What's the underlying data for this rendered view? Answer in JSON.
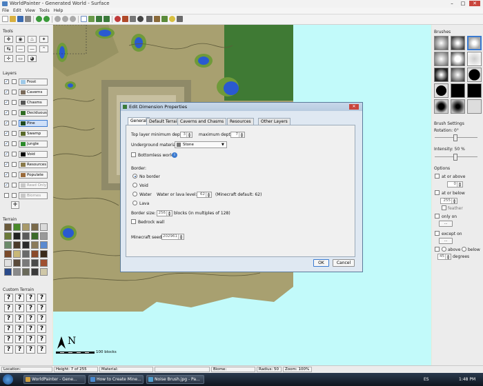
{
  "window": {
    "title": "WorldPainter - Generated World - Surface",
    "controls": [
      "–",
      "□",
      "✕"
    ]
  },
  "menu": [
    "File",
    "Edit",
    "View",
    "Tools",
    "Help"
  ],
  "tools_panel": {
    "label": "Tools",
    "icons": [
      "✥",
      "◉",
      "♨",
      "✦",
      "↹",
      "—",
      "—",
      "⌃",
      "✛",
      "▭",
      "◕"
    ]
  },
  "layers_panel": {
    "label": "Layers",
    "layers": [
      {
        "name": "Frost",
        "color": "#9ec9e8",
        "checked": true
      },
      {
        "name": "Caverns",
        "color": "#7a6a5a",
        "checked": true
      },
      {
        "name": "Chasms",
        "color": "#555555",
        "checked": true
      },
      {
        "name": "Deciduous",
        "color": "#2e6b22",
        "checked": true
      },
      {
        "name": "Pine",
        "color": "#1e4a1e",
        "checked": true,
        "selected": true
      },
      {
        "name": "Swamp",
        "color": "#5a6a2a",
        "checked": true
      },
      {
        "name": "Jungle",
        "color": "#2a8a2a",
        "checked": true
      },
      {
        "name": "Void",
        "color": "#000000",
        "checked": true
      },
      {
        "name": "Resources",
        "color": "#8a7a4a",
        "checked": true
      },
      {
        "name": "Populate",
        "color": "#9a6a3a",
        "checked": true
      },
      {
        "name": "Read Only",
        "color": "#c8c8c8",
        "checked": true,
        "disabled": true
      },
      {
        "name": "Biomes",
        "color": "#c8c8c8",
        "checked": false,
        "disabled": true
      }
    ],
    "add_label": "+"
  },
  "terrain_panel": {
    "label": "Terrain",
    "swatches": [
      "#6a5a3a",
      "#4a8a2a",
      "#a89a6a",
      "#7a6a4a",
      "#dadada",
      "#6a7a3a",
      "#222222",
      "#5a5a5a",
      "#3a6a2a",
      "#9a9a9a",
      "#6a8a6a",
      "#4a3a2a",
      "#2a2a2a",
      "#8a7a5a",
      "#5a8ad0",
      "#7a4a2a",
      "#c8b878",
      "#6a6a6a",
      "#8a4a2a",
      "#3a2a1a",
      "#e0e0e0",
      "#5a4a3a",
      "#7a7a7a",
      "#4a4a4a",
      "#a05030",
      "#2a4a8a",
      "#8a8a8a",
      "#6a6a5a",
      "#3a3a3a",
      "#d0c8a8"
    ]
  },
  "custom_terrain_panel": {
    "label": "Custom Terrain",
    "placeholder": "?",
    "count": 24
  },
  "brushes_panel": {
    "label": "Brushes"
  },
  "brush_settings": {
    "label": "Brush Settings",
    "rotation": "Rotation: 0°",
    "rotation_value": 0,
    "intensity": "Intensity: 50 %",
    "intensity_value": 50
  },
  "options": {
    "label": "Options",
    "at_or_above": "at or above",
    "at_or_above_value": "0",
    "at_or_below": "at or below",
    "at_or_below_value": "255",
    "feather": "feather",
    "only_on": "only on",
    "only_on_value": "...",
    "except_on": "except on",
    "except_on_value": "...",
    "above": "above",
    "below": "below",
    "degrees_value": "45",
    "degrees": "degrees"
  },
  "map": {
    "scale_label": "100 blocks",
    "compass": "N",
    "land_color": "#a8a070",
    "water_color": "#c2fafa"
  },
  "dialog": {
    "title": "Edit Dimension Properties",
    "tabs": [
      "General",
      "Default Terrain",
      "Caverns and Chasms",
      "Resources",
      "Other Layers"
    ],
    "active_tab": "General",
    "top_layer_label": "Top layer minimum depth:",
    "top_layer_value": "3",
    "max_depth_label": "maximum depth:",
    "max_depth_value": "7",
    "underground_label": "Underground material:",
    "underground_value": "Stone",
    "bottomless_label": "Bottomless world",
    "border_label": "Border:",
    "border_options": [
      "No border",
      "Void",
      "Water",
      "Lava"
    ],
    "water_level_label": "Water or lava level:",
    "water_level_value": "62",
    "minecraft_default": "(Minecraft default: 62)",
    "border_size_label": "Border size:",
    "border_size_value": "256",
    "border_size_suffix": "blocks (in multiples of 128)",
    "bedrock_label": "Bedrock wall",
    "seed_label": "Minecraft seed:",
    "seed_value": "202961",
    "ok_label": "OK",
    "cancel_label": "Cancel"
  },
  "status": {
    "location": "Location:",
    "height": "Height: 7 of 255",
    "material": "Material:",
    "biome": "Biome:",
    "radius": "Radius: 50",
    "zoom": "Zoom: 100%"
  },
  "taskbar": {
    "items": [
      {
        "label": "WorldPainter - Gene...",
        "color": "#d0a040"
      },
      {
        "label": "How to Create Mine...",
        "color": "#4a8ad0"
      },
      {
        "label": "Noise Brush.jpg - Pa...",
        "color": "#50a0d0"
      }
    ],
    "lang": "ES",
    "time": "1:48 PM"
  }
}
